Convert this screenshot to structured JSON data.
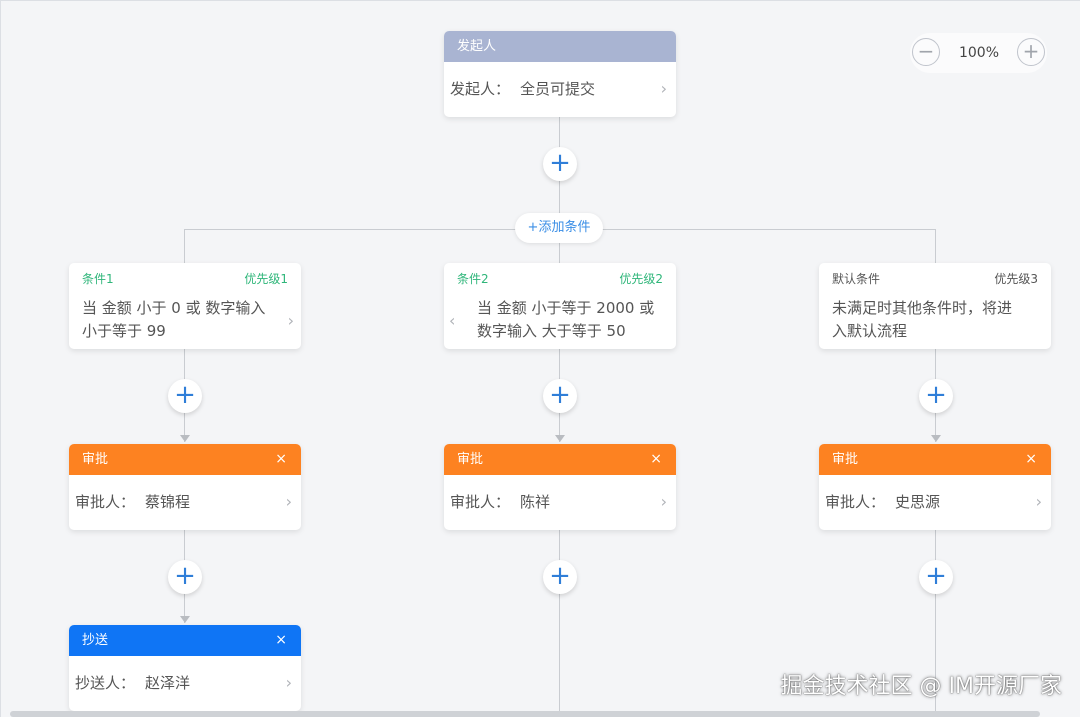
{
  "zoom": {
    "minus": "−",
    "value": "100%",
    "plus": "+"
  },
  "starter": {
    "title": "发起人",
    "label": "发起人：",
    "value": "全员可提交",
    "chevron": "›"
  },
  "add_condition_label": "+添加条件",
  "plus_symbol": "+",
  "branches": [
    {
      "condition": {
        "title": "条件1",
        "priority": "优先级1",
        "desc": "当 金额 小于 0 或 数字输入 小于等于 99",
        "chevron": "›"
      },
      "approve": {
        "title": "审批",
        "close": "×",
        "label": "审批人：",
        "value": "蔡锦程",
        "chevron": "›"
      },
      "cc": {
        "title": "抄送",
        "close": "×",
        "label": "抄送人：",
        "value": "赵泽洋",
        "chevron": "›"
      }
    },
    {
      "condition": {
        "title": "条件2",
        "priority": "优先级2",
        "desc": "当 金额 小于等于 2000 或 数字输入 大于等于 50",
        "chevron": "‹"
      },
      "approve": {
        "title": "审批",
        "close": "×",
        "label": "审批人：",
        "value": "陈祥",
        "chevron": "›"
      }
    },
    {
      "condition": {
        "title": "默认条件",
        "priority": "优先级3",
        "desc": "未满足时其他条件时，将进入默认流程"
      },
      "approve": {
        "title": "审批",
        "close": "×",
        "label": "审批人：",
        "value": "史思源",
        "chevron": "›"
      }
    }
  ],
  "icons": {
    "plus": "plus-icon",
    "close": "close-icon",
    "chevron": "chevron-right-icon"
  },
  "colors": {
    "approve_header": "#fd8221",
    "cc_header": "#0f75f5",
    "starter_header": "#a9b4d2",
    "condition_text": "#2fb67a",
    "add_button": "#2f7ed8"
  },
  "watermark": "掘金技术社区 @ IM开源厂家"
}
